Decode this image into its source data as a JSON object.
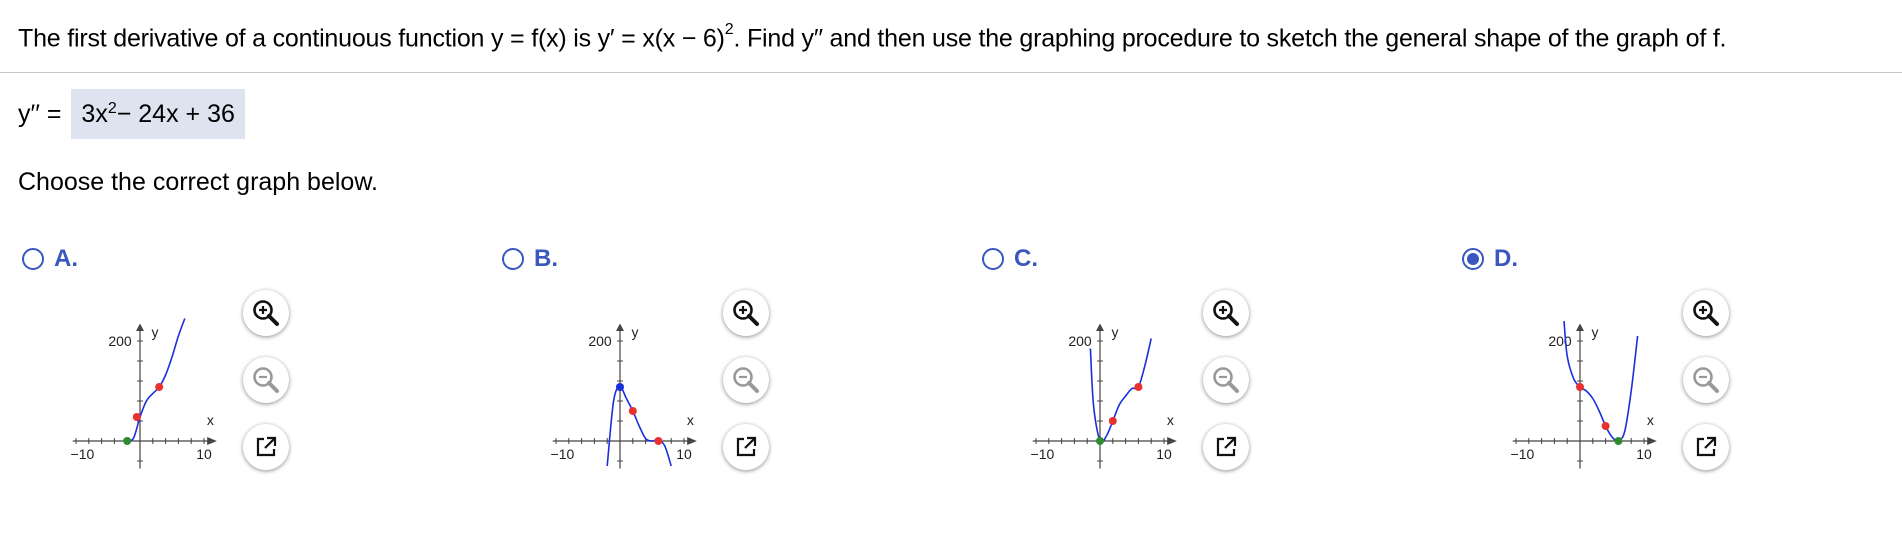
{
  "question": {
    "part1": "The first derivative of a continuous function y = f(x) is y′ = x(x − 6)",
    "exp": "2",
    "part2": ". Find y′′ and then use the graphing procedure to sketch the general shape of the graph of f."
  },
  "answer": {
    "label": "y′′ =",
    "value_a": "3x",
    "value_exp": "2",
    "value_b": " − 24x + 36"
  },
  "instruction": "Choose the correct graph below.",
  "graph_labels": {
    "x_axis": "x",
    "y_axis": "y",
    "x_min": "−10",
    "x_max": "10",
    "y_tick": "200"
  },
  "colors": {
    "accent": "#3a57c0",
    "curve": "#1a2fdc",
    "inflection": "#e8322e",
    "extremum_min": "#2e8b2e",
    "extremum_max": "#1a2fdc"
  },
  "options": [
    {
      "letter": "A.",
      "selected": false,
      "chart_data": {
        "type": "line",
        "xlim": [
          -10,
          10
        ],
        "ylim": [
          -50,
          200
        ],
        "x": [
          -2.5,
          -2,
          -1,
          0,
          1,
          2,
          3,
          4,
          5,
          6,
          7
        ],
        "y": [
          5,
          0,
          6,
          48,
          80,
          95,
          108,
          132,
          168,
          210,
          245
        ],
        "points": [
          {
            "x": -2,
            "y": 0,
            "kind": "minimum"
          },
          {
            "x": -0.5,
            "y": 48,
            "kind": "inflection"
          },
          {
            "x": 3,
            "y": 108,
            "kind": "inflection"
          }
        ]
      }
    },
    {
      "letter": "B.",
      "selected": false,
      "chart_data": {
        "type": "line",
        "xlim": [
          -10,
          10
        ],
        "ylim": [
          -50,
          200
        ],
        "x": [
          -2,
          -1,
          0,
          1,
          2,
          3,
          4,
          5,
          6,
          7,
          8
        ],
        "y": [
          -50,
          80,
          108,
          85,
          60,
          30,
          5,
          0,
          2,
          -10,
          -50
        ],
        "points": [
          {
            "x": 0,
            "y": 108,
            "kind": "maximum"
          },
          {
            "x": 2,
            "y": 60,
            "kind": "inflection"
          },
          {
            "x": 6,
            "y": 0,
            "kind": "inflection"
          }
        ]
      }
    },
    {
      "letter": "C.",
      "selected": false,
      "chart_data": {
        "type": "line",
        "xlim": [
          -10,
          10
        ],
        "ylim": [
          -50,
          200
        ],
        "x": [
          -1.5,
          -1,
          0,
          1,
          2,
          3,
          4,
          5,
          6,
          7,
          8
        ],
        "y": [
          185,
          70,
          0,
          10,
          40,
          72,
          90,
          105,
          108,
          150,
          205
        ],
        "points": [
          {
            "x": 0,
            "y": 0,
            "kind": "minimum"
          },
          {
            "x": 2,
            "y": 40,
            "kind": "inflection"
          },
          {
            "x": 6,
            "y": 108,
            "kind": "inflection"
          }
        ]
      }
    },
    {
      "letter": "D.",
      "selected": true,
      "chart_data": {
        "type": "line",
        "xlim": [
          -10,
          10
        ],
        "ylim": [
          -50,
          200
        ],
        "x": [
          -2.5,
          -2,
          -1,
          0,
          1,
          2,
          3,
          4,
          5,
          6,
          7,
          8,
          9
        ],
        "y": [
          240,
          170,
          125,
          108,
          100,
          85,
          60,
          30,
          8,
          0,
          20,
          100,
          210
        ],
        "points": [
          {
            "x": 0,
            "y": 108,
            "kind": "inflection"
          },
          {
            "x": 4,
            "y": 30,
            "kind": "inflection"
          },
          {
            "x": 6,
            "y": 0,
            "kind": "minimum"
          }
        ]
      }
    }
  ],
  "tools": {
    "zoom_in": "zoom-in",
    "zoom_out": "zoom-out",
    "popout": "open-in-new-window"
  }
}
